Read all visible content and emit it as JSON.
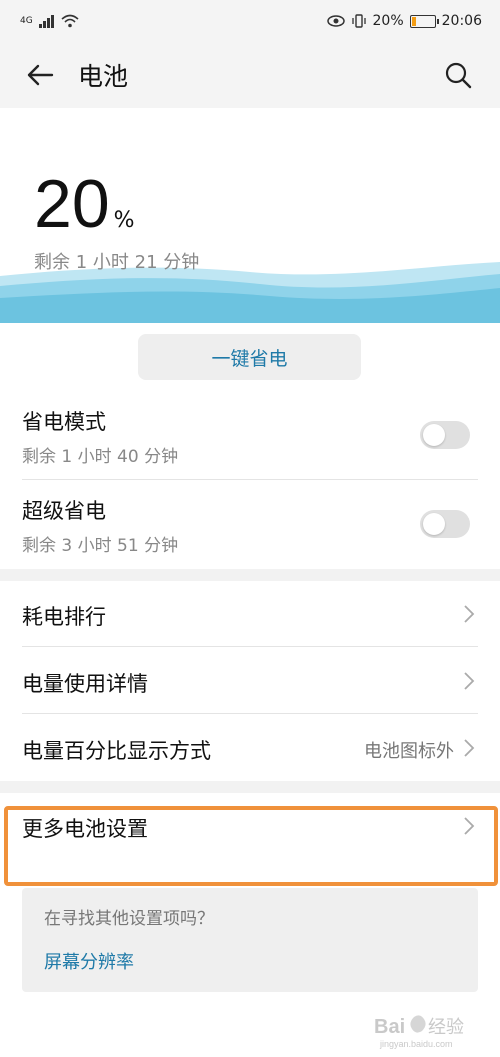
{
  "status_bar": {
    "signal_label": "4G",
    "battery_pct": "20%",
    "time": "20:06"
  },
  "header": {
    "title": "电池"
  },
  "hero": {
    "percent": "20",
    "percent_sign": "%",
    "remaining": "剩余 1 小时 21 分钟"
  },
  "one_key_save": {
    "label": "一键省电"
  },
  "power_saving": {
    "title": "省电模式",
    "subtitle": "剩余 1 小时 40 分钟",
    "enabled": false
  },
  "ultra_saving": {
    "title": "超级省电",
    "subtitle": "剩余 3 小时 51 分钟",
    "enabled": false
  },
  "menu": {
    "ranking": "耗电排行",
    "usage_details": "电量使用详情",
    "percentage_display": "电量百分比显示方式",
    "percentage_display_value": "电池图标外",
    "more_settings": "更多电池设置"
  },
  "suggestion": {
    "question": "在寻找其他设置项吗？",
    "link": "屏幕分辨率"
  },
  "watermark": {
    "brand": "Baidu 经验",
    "url": "jingyan.baidu.com"
  },
  "colors": {
    "accent": "#1f7aa8",
    "highlight_border": "#f0913a",
    "wave": "#6cc3e0",
    "battery_fill": "#f39c12"
  }
}
